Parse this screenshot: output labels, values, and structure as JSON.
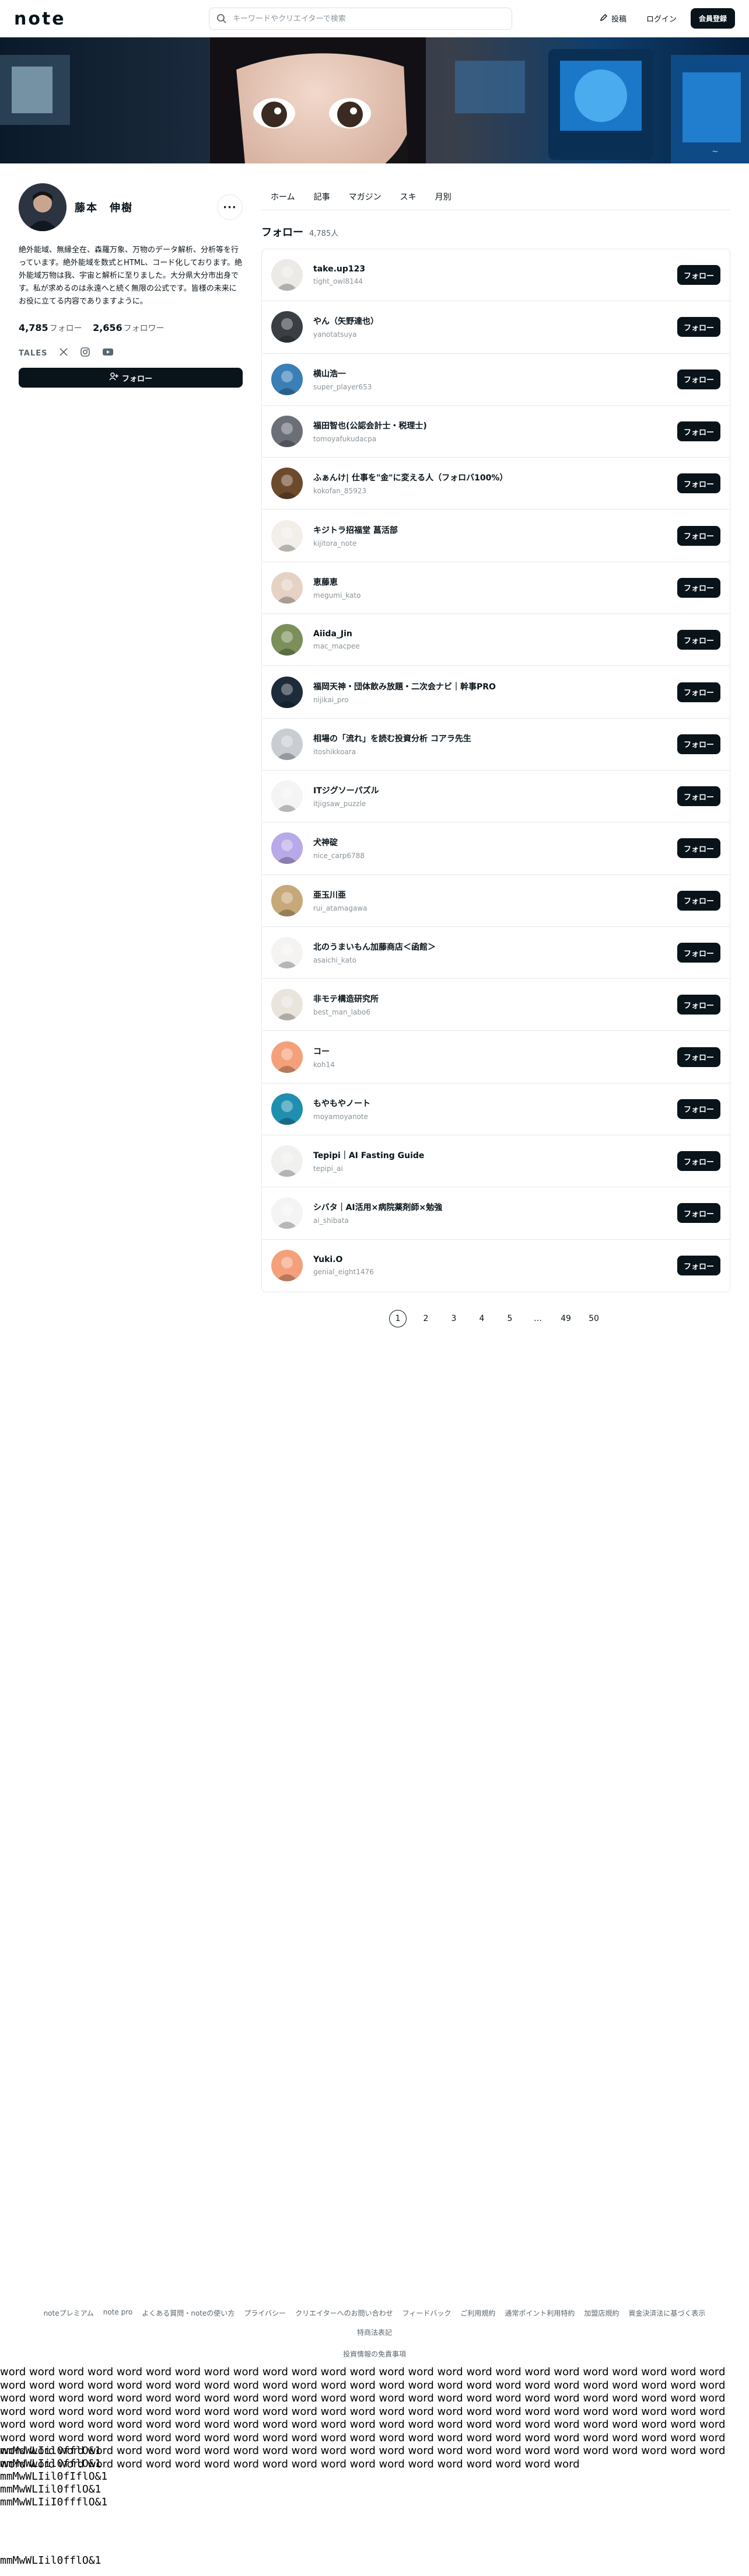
{
  "header": {
    "logo": "note",
    "search_placeholder": "キーワードやクリエイターで検索",
    "post_label": "投稿",
    "login_label": "ログイン",
    "register_label": "会員登録"
  },
  "profile": {
    "name": "藤本　伸樹",
    "bio": "絶外能域、無縁全在、森羅万象、万物のデータ解析、分析等を行っています。絶外能域を数式とHTML、コード化しております。絶外能域万物は我、宇宙と解析に至りました。大分県大分市出身です。私が求めるのは永遠へと続く無限の公式です。皆様の未来にお役に立てる内容でありますように。",
    "follow_count": "4,785",
    "follow_label": "フォロー",
    "follower_count": "2,656",
    "follower_label": "フォロワー",
    "tales_label": "TALES",
    "follow_button": "フォロー"
  },
  "tabs": [
    "ホーム",
    "記事",
    "マガジン",
    "スキ",
    "月別"
  ],
  "section": {
    "title": "フォロー",
    "count": "4,785人"
  },
  "users": [
    {
      "name": "take.up123",
      "id": "tight_owl8144",
      "bg": "#eceae6"
    },
    {
      "name": "やん（矢野達也）",
      "id": "yanotatsuya",
      "bg": "#3b3f44"
    },
    {
      "name": "横山浩一",
      "id": "super_player653",
      "bg": "#3a7fb5"
    },
    {
      "name": "福田智也(公認会計士・税理士)",
      "id": "tomoyafukudacpa",
      "bg": "#6b7078"
    },
    {
      "name": "ふぁんけ| 仕事を\"金\"に変える人（フォロバ100%）",
      "id": "kokofan_85923",
      "bg": "#6d4a2c"
    },
    {
      "name": "キジトラ招福堂 菖活部",
      "id": "kijitora_note",
      "bg": "#f2efe9"
    },
    {
      "name": "恵藤恵",
      "id": "megumi_kato",
      "bg": "#e5d2c4"
    },
    {
      "name": "Aiida_Jin",
      "id": "mac_macpee",
      "bg": "#7a8f5a"
    },
    {
      "name": "福岡天神・団体飲み放題・二次会ナビ｜幹事PRO",
      "id": "nijikai_pro",
      "bg": "#1e2b3a"
    },
    {
      "name": "相場の「流れ」を読む投資分析 コアラ先生",
      "id": "itoshikkoara",
      "bg": "#c9cdd2"
    },
    {
      "name": "ITジグソーパズル",
      "id": "itjigsaw_puzzle",
      "bg": "#f4f4f4"
    },
    {
      "name": "犬神碇",
      "id": "nice_carp6788",
      "bg": "#b8a9e8"
    },
    {
      "name": "亜玉川亜",
      "id": "rui_atamagawa",
      "bg": "#c7a878"
    },
    {
      "name": "北のうまいもん加藤商店＜函館＞",
      "id": "asaichi_kato",
      "bg": "#f5f2f2"
    },
    {
      "name": "非モテ構造研究所",
      "id": "best_man_labo6",
      "bg": "#e9e4dc"
    },
    {
      "name": "コー",
      "id": "koh14",
      "bg": "#f4a07a"
    },
    {
      "name": "もやもやノート",
      "id": "moyamoyanote",
      "bg": "#1f8fb0"
    },
    {
      "name": "Tepipi｜AI Fasting Guide",
      "id": "tepipi_ai",
      "bg": "#f0f0ee"
    },
    {
      "name": "シバタ｜AI活用×病院薬剤師×勉強",
      "id": "ai_shibata",
      "bg": "#f4f4f4"
    },
    {
      "name": "Yuki.O",
      "id": "genial_eight1476",
      "bg": "#f4a07a"
    }
  ],
  "user_follow_label": "フォロー",
  "pager": [
    "1",
    "2",
    "3",
    "4",
    "5",
    "…",
    "49",
    "50"
  ],
  "footer": {
    "links": [
      "noteプレミアム",
      "note pro",
      "よくある質問・noteの使い方",
      "プライバシー",
      "クリエイターへのお問い合わせ",
      "フィードバック",
      "ご利用規約",
      "通常ポイント利用特約",
      "加盟店規約",
      "資金決済法に基づく表示",
      "特商法表記"
    ],
    "second": "投資情報の免責事項"
  },
  "filler_text": "word word word word word word word word word word word word word word word word word word word word word word word word word word word word word word word word word word word word word word word word word word word word word word word word word word word word word word word word word word word word word word word word word word word word word word word word word word word word word word word word word word word word word word word word word word word word word word word word word word word word word word word word word word word word word word word word word word word word word word word word word word word word word word word word word word word word word word word word word word word word word word word word word word word word word word word word word word word word word word word word word word word word word word word word word word word word word word word word word word word word word word word word word word word word word word word word word word word",
  "mono_lines": [
    "mmMwWLIil0fflO&1",
    "mmMwWLIil0fflO&1",
    "mmMwWLIil0fIflO&1",
    "mmMwWLIil0fflO&1",
    "mmMwWLIiI0ffflO&1",
    "mmMwWLIil0fflO&1"
  ]
}
